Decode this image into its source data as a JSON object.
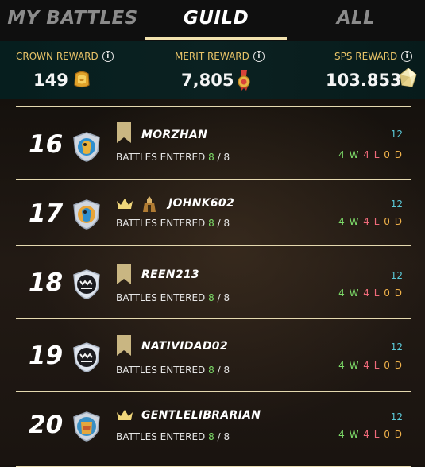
{
  "tabs": [
    {
      "label": "MY BATTLES",
      "active": false
    },
    {
      "label": "GUILD",
      "active": true
    },
    {
      "label": "ALL",
      "active": false
    }
  ],
  "rewards": {
    "crown": {
      "label": "CROWN REWARD",
      "value": "149",
      "icon": "crown-token-icon"
    },
    "merit": {
      "label": "MERIT REWARD",
      "value": "7,805",
      "icon": "merit-medal-icon"
    },
    "sps": {
      "label": "SPS REWARD",
      "value": "103.853",
      "icon": "sps-crystal-icon"
    }
  },
  "rows": [
    {
      "rank": "16",
      "name": "MORZHAN",
      "battles_label": "BATTLES ENTERED",
      "entered": "8",
      "sep": " / ",
      "total": "8",
      "score": "12",
      "w": "4",
      "w_s": "W",
      "l": "4",
      "l_s": "L",
      "d": "0",
      "d_s": "D",
      "avatar": "blue-bird-shield-icon",
      "flag": true,
      "crown": false,
      "guild_icon": false
    },
    {
      "rank": "17",
      "name": "JOHNK602",
      "battles_label": "BATTLES ENTERED",
      "entered": "8",
      "sep": " / ",
      "total": "8",
      "score": "12",
      "w": "4",
      "w_s": "W",
      "l": "4",
      "l_s": "L",
      "d": "0",
      "d_s": "D",
      "avatar": "gold-bird-shield-icon",
      "flag": false,
      "crown": true,
      "guild_icon": true
    },
    {
      "rank": "18",
      "name": "REEN213",
      "battles_label": "BATTLES ENTERED",
      "entered": "8",
      "sep": " / ",
      "total": "8",
      "score": "12",
      "w": "4",
      "w_s": "W",
      "l": "4",
      "l_s": "L",
      "d": "0",
      "d_s": "D",
      "avatar": "dark-monster-shield-icon",
      "flag": true,
      "crown": false,
      "guild_icon": false
    },
    {
      "rank": "19",
      "name": "NATIVIDAD02",
      "battles_label": "BATTLES ENTERED",
      "entered": "8",
      "sep": " / ",
      "total": "8",
      "score": "12",
      "w": "4",
      "w_s": "W",
      "l": "4",
      "l_s": "L",
      "d": "0",
      "d_s": "D",
      "avatar": "dark-monster-shield-icon",
      "flag": true,
      "crown": false,
      "guild_icon": false
    },
    {
      "rank": "20",
      "name": "GENTLELIBRARIAN",
      "battles_label": "BATTLES ENTERED",
      "entered": "8",
      "sep": " / ",
      "total": "8",
      "score": "12",
      "w": "4",
      "w_s": "W",
      "l": "4",
      "l_s": "L",
      "d": "0",
      "d_s": "D",
      "avatar": "gold-monster-shield-icon",
      "flag": false,
      "crown": true,
      "guild_icon": false
    }
  ]
}
